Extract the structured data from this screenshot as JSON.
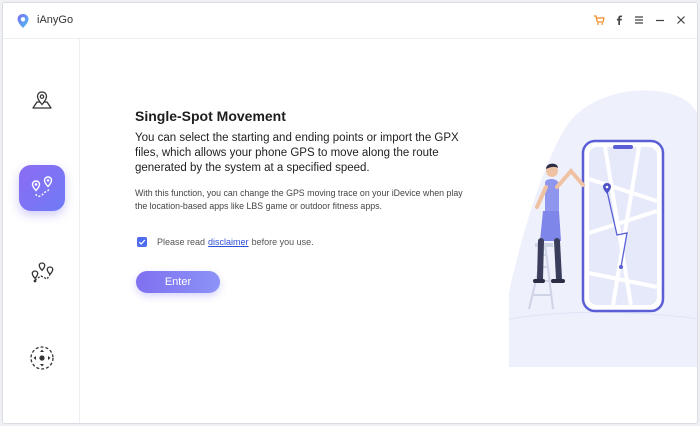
{
  "app": {
    "title": "iAnyGo"
  },
  "titlebar": {
    "controls": [
      "cart-icon",
      "facebook-icon",
      "menu-icon",
      "minimize-icon",
      "close-icon"
    ],
    "cart_color": "#f08a24"
  },
  "sidebar": {
    "items": [
      {
        "name": "single-location",
        "icon": "map-pin-icon",
        "active": false
      },
      {
        "name": "single-spot-movement",
        "icon": "route-pins-icon",
        "active": true
      },
      {
        "name": "multi-spot-movement",
        "icon": "multi-route-icon",
        "active": false
      },
      {
        "name": "joystick-movement",
        "icon": "joystick-icon",
        "active": false
      }
    ],
    "accent": "#7c6ff2"
  },
  "main": {
    "heading": "Single-Spot Movement",
    "description": "You can select the starting and ending points or import the GPX files, which allows your phone GPS to move along the route generated by the system at a specified speed.",
    "note": "With this function, you can change the GPS moving trace on your iDevice when play the location-based apps like LBS game or outdoor fitness apps.",
    "agree": {
      "checked": true,
      "prefix": "Please read",
      "link": "disclaimer",
      "suffix": "before you use."
    },
    "enter_label": "Enter"
  },
  "colors": {
    "link": "#2f4fd8",
    "checkbox": "#4d6cf0",
    "button_start": "#7f70f0",
    "button_end": "#8c93f7"
  }
}
